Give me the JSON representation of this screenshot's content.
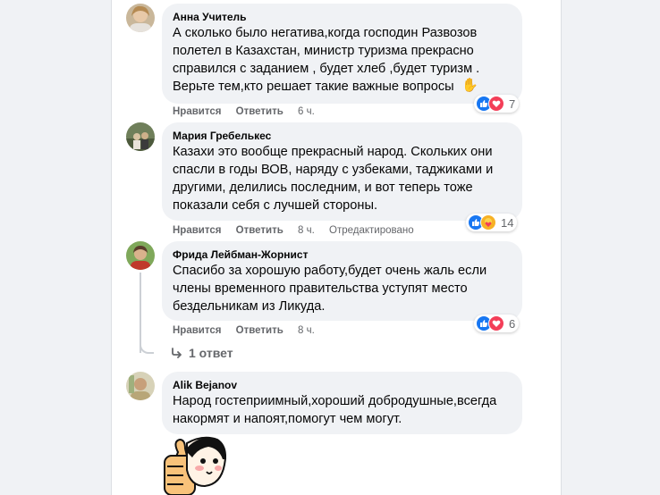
{
  "comments": [
    {
      "author": "Анна Учитель",
      "text": "А сколько было негатива,когда господин Развозов\nполетел в Казахстан, министр туризма прекрасно\nсправился с заданием , будет хлеб ,будет туризм .\nВерьте тем,кто решает такие важные вопросы",
      "like_label": "Нравится",
      "reply_label": "Ответить",
      "time": "6 ч.",
      "reactions": [
        "like-icon",
        "love-icon"
      ],
      "reaction_count": "7"
    },
    {
      "author": "Мария Гребелькес",
      "text": "Казахи это вообще прекрасный народ. Скольких они\nспасли в годы ВОВ, наряду с узбеками, таджиками и\nдругими, делились последним, и вот теперь тоже\nпоказали себя с лучшей стороны.",
      "like_label": "Нравится",
      "reply_label": "Ответить",
      "time": "8 ч.",
      "edited": "Отредактировано",
      "reactions": [
        "like-icon",
        "care-icon"
      ],
      "reaction_count": "14"
    },
    {
      "author": "Фрида Лейбман-Жорнист",
      "text": "Спасибо за хорошую работу,будет очень жаль если\nчлены временного правительства уступят место\nбездельникам из Ликуда.",
      "like_label": "Нравится",
      "reply_label": "Ответить",
      "time": "8 ч.",
      "reactions": [
        "like-icon",
        "love-icon"
      ],
      "reaction_count": "6",
      "replies_label": "1 ответ"
    },
    {
      "author": "Alik Bejanov",
      "text": "Народ гостеприимный,хороший добродушные,всегда\nнакормят и напоят,помогут чем могут."
    }
  ],
  "colors": {
    "like": "#1877f2",
    "love": "#f33e58",
    "care": "#f7b125",
    "bubble": "#f0f2f5",
    "meta": "#65676b"
  }
}
